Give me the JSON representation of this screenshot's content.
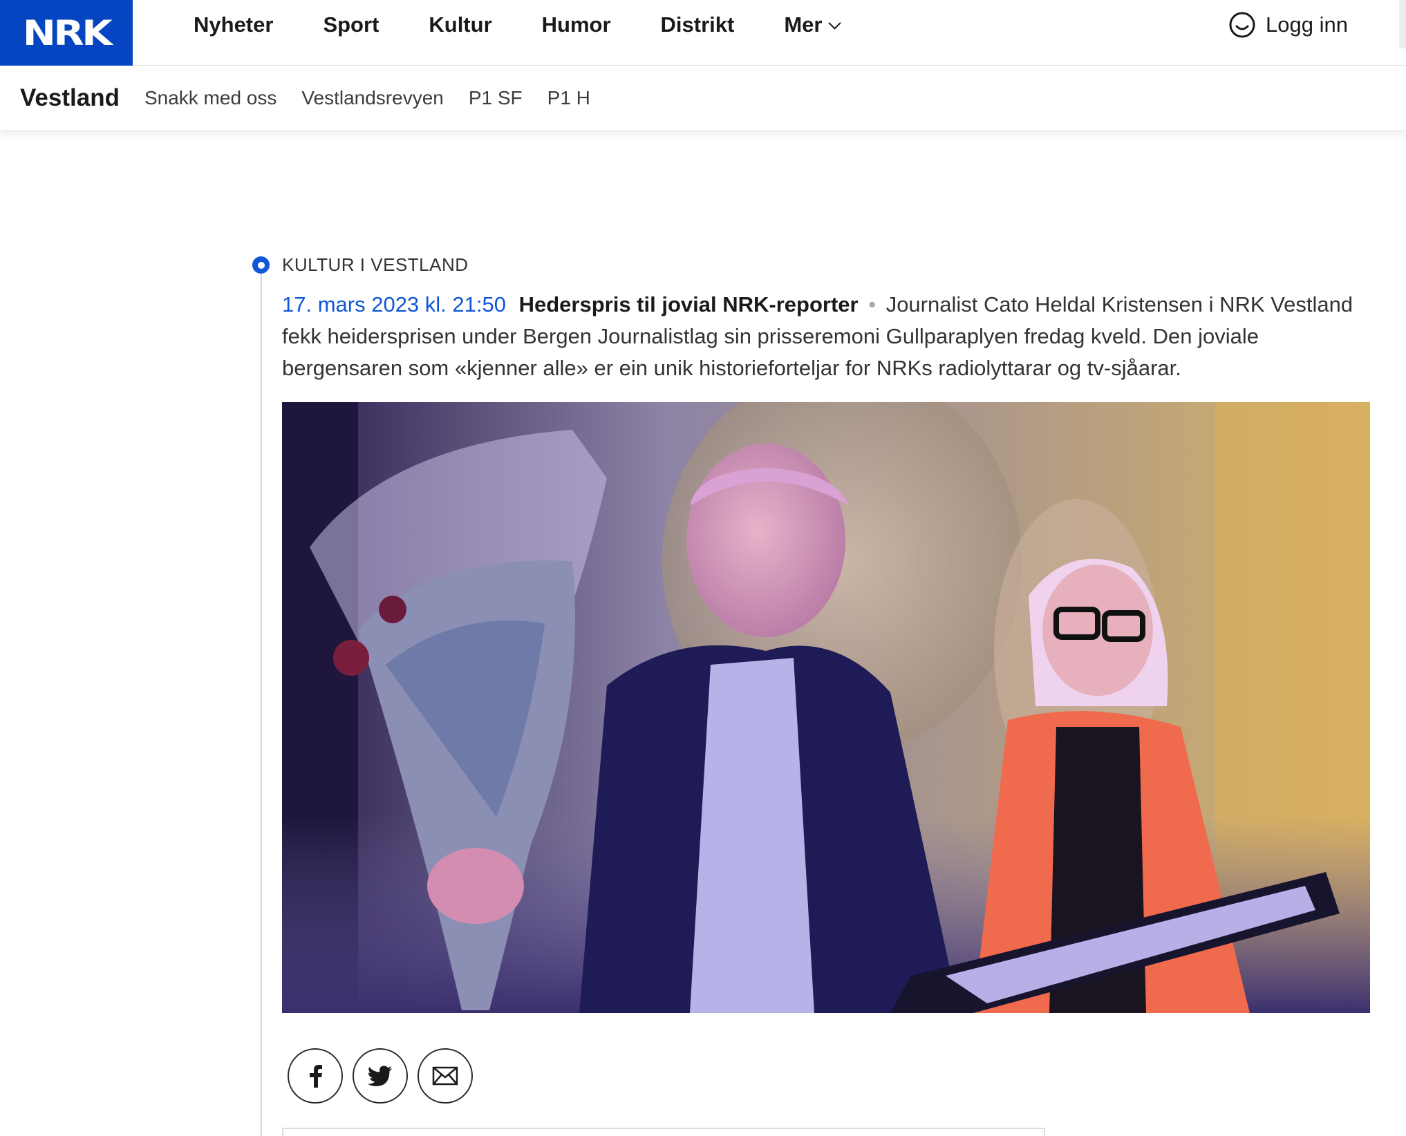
{
  "brand": {
    "logo_text": "NRK",
    "color": "#0645c2"
  },
  "nav": {
    "items": [
      {
        "label": "Nyheter"
      },
      {
        "label": "Sport"
      },
      {
        "label": "Kultur"
      },
      {
        "label": "Humor"
      },
      {
        "label": "Distrikt"
      },
      {
        "label": "Mer"
      }
    ],
    "login_label": "Logg inn"
  },
  "subnav": {
    "region": "Vestland",
    "items": [
      {
        "label": "Snakk med oss"
      },
      {
        "label": "Vestlandsrevyen"
      },
      {
        "label": "P1 SF"
      },
      {
        "label": "P1 H"
      }
    ]
  },
  "article": {
    "kicker": "KULTUR I VESTLAND",
    "date": "17. mars 2023 kl. 21:50",
    "headline": "Hederspris til jovial NRK-reporter",
    "separator": "•",
    "body": "Journalist Cato Heldal Kristensen i NRK Vestland fekk heidersprisen under Bergen Journalistlag sin prisseremoni Gullparaplyen fredag kveld. Den joviale bergensaren som «kjenner alle» er ein unik historieforteljar for NRKs radiolyttarar og tv-sjåarar.",
    "accent_color": "#0f56d9"
  },
  "share": {
    "icons": [
      "facebook-icon",
      "twitter-icon",
      "email-icon"
    ]
  }
}
